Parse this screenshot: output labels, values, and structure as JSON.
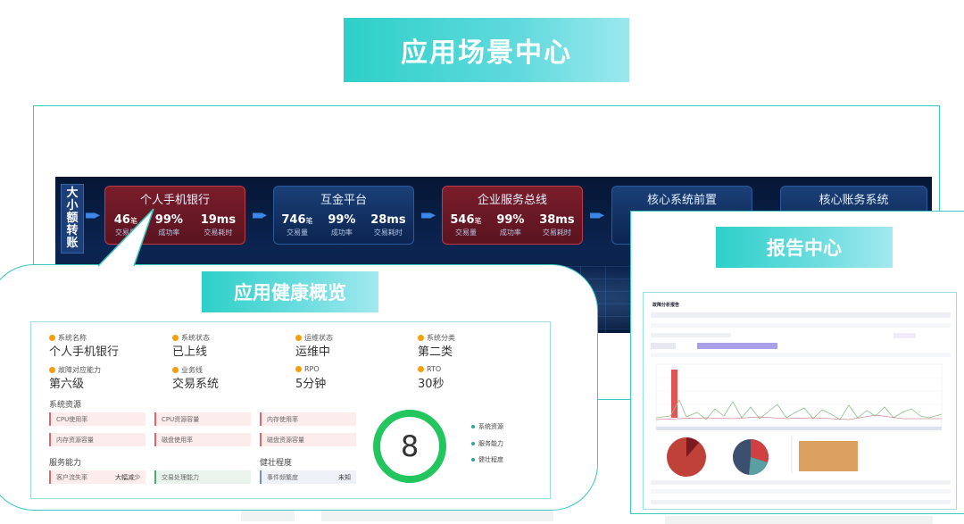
{
  "title": "应用场景中心",
  "banner": {
    "side_tag": [
      "大",
      "小",
      "额",
      "转",
      "账"
    ],
    "cards": [
      {
        "name": "个人手机银行",
        "highlight": true,
        "metrics": [
          {
            "value": "46",
            "unit": "笔",
            "label": "交易量"
          },
          {
            "value": "99%",
            "unit": "",
            "label": "成功率"
          },
          {
            "value": "19ms",
            "unit": "",
            "label": "交易耗时"
          }
        ]
      },
      {
        "name": "互金平台",
        "highlight": false,
        "metrics": [
          {
            "value": "746",
            "unit": "笔",
            "label": "交易量"
          },
          {
            "value": "99%",
            "unit": "",
            "label": "成功率"
          },
          {
            "value": "28ms",
            "unit": "",
            "label": "交易耗时"
          }
        ]
      },
      {
        "name": "企业服务总线",
        "highlight": true,
        "metrics": [
          {
            "value": "546",
            "unit": "笔",
            "label": "交易量"
          },
          {
            "value": "99%",
            "unit": "",
            "label": "成功率"
          },
          {
            "value": "38ms",
            "unit": "",
            "label": "交易耗时"
          }
        ]
      },
      {
        "name": "核心系统前置",
        "highlight": false,
        "metrics": []
      },
      {
        "name": "核心账务系统",
        "highlight": false,
        "metrics": []
      }
    ]
  },
  "health": {
    "title": "应用健康概览",
    "fields": [
      {
        "label": "系统名称",
        "value": "个人手机银行",
        "color": "#f59e0b"
      },
      {
        "label": "系统状态",
        "value": "已上线",
        "color": "#f59e0b"
      },
      {
        "label": "运维状态",
        "value": "运维中",
        "color": "#f59e0b"
      },
      {
        "label": "系统分类",
        "value": "第二类",
        "color": "#f59e0b"
      },
      {
        "label": "故障对应能力",
        "value": "第六级",
        "color": "#f59e0b"
      },
      {
        "label": "业务线",
        "value": "交易系统",
        "color": "#f59e0b"
      },
      {
        "label": "RPO",
        "value": "5分钟",
        "color": "#f59e0b"
      },
      {
        "label": "RTO",
        "value": "30秒",
        "color": "#f59e0b"
      }
    ],
    "resource_title": "系统资源",
    "resources": [
      "CPU使用率",
      "CPU资源容量",
      "内存使用率",
      "内存资源容量",
      "磁盘使用率",
      "磁盘资源容量"
    ],
    "service_title": "服务能力",
    "services": [
      {
        "label": "客户流失率",
        "value": "大幅减少"
      },
      {
        "label": "交易处理能力",
        "value": ""
      }
    ],
    "robust_title": "健壮程度",
    "robust": [
      {
        "label": "事件频繁度",
        "value": "未知"
      }
    ],
    "score": "8",
    "legend": [
      "系统资源",
      "服务能力",
      "健壮程度"
    ]
  },
  "report": {
    "title": "报告中心",
    "doc_title": "故障分析报告"
  },
  "colors": {
    "accent": "#38c8c0",
    "score_ring": "#22c55e",
    "card_red": "#7a1d2a",
    "banner_bg": "#0b2450"
  }
}
